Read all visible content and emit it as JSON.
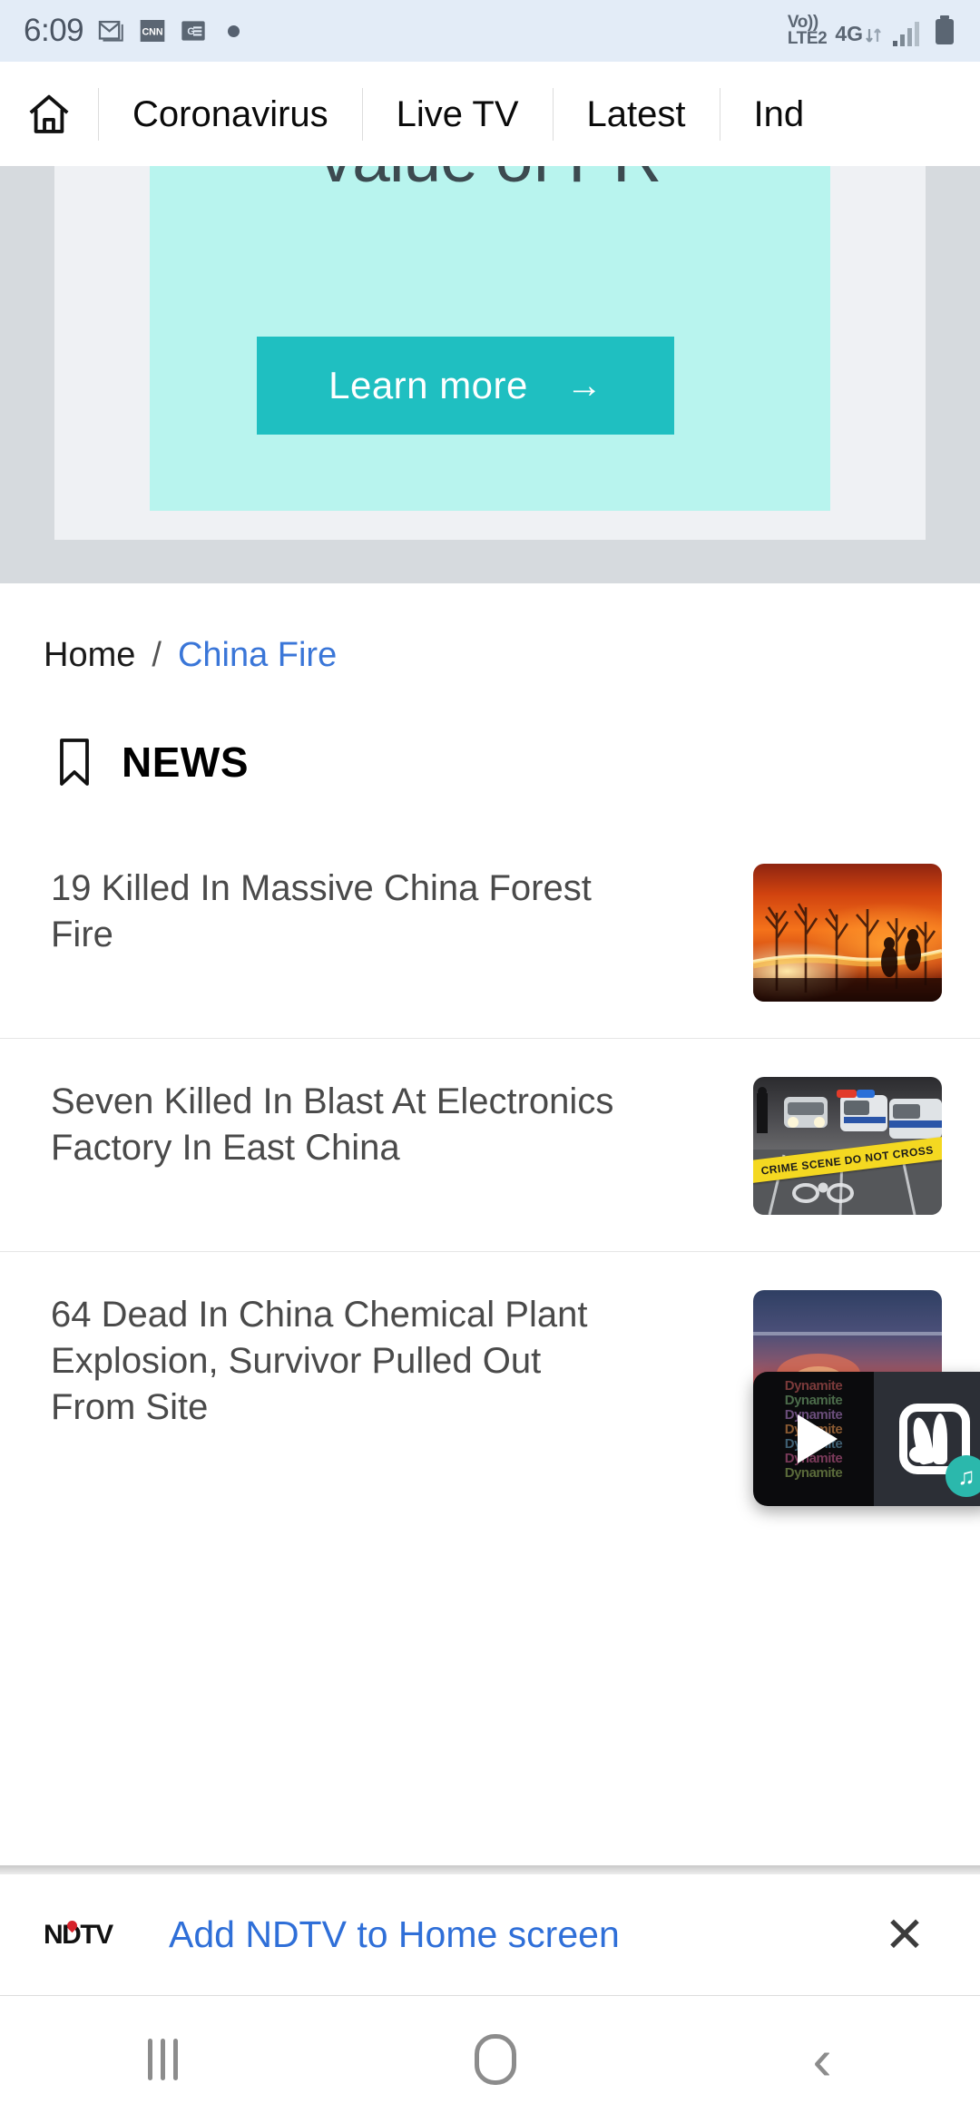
{
  "status_bar": {
    "time": "6:09",
    "icons": [
      "gmail-icon",
      "cnn-icon",
      "google-news-icon",
      "notification-dot"
    ],
    "volte_line1": "Vo))",
    "volte_line2": "LTE2",
    "network": "4G",
    "signal": "signal-bars-icon",
    "battery": "battery-full-icon"
  },
  "nav": {
    "home_icon": "home-icon",
    "items": [
      {
        "label": "Coronavirus"
      },
      {
        "label": "Live TV"
      },
      {
        "label": "Latest"
      },
      {
        "label": "Ind"
      }
    ]
  },
  "ad": {
    "headline": "value of PR",
    "button_label": "Learn more",
    "button_arrow": "→",
    "bg_color": "#b8f4ee",
    "button_color": "#1fbfc1"
  },
  "breadcrumb": {
    "home": "Home",
    "separator": "/",
    "current": "China Fire",
    "link_color": "#3a76d8"
  },
  "section": {
    "icon": "bookmark-icon",
    "title": "NEWS"
  },
  "news": [
    {
      "title": "19 Killed In Massive China Forest Fire",
      "thumbnail": "forest-fire-photo"
    },
    {
      "title": "Seven Killed In Blast At Electronics Factory In East China",
      "thumbnail": "crime-scene-tape-photo",
      "tape_text": "CRIME SCENE DO NOT CROSS"
    },
    {
      "title": "64 Dead In China Chemical Plant Explosion, Survivor Pulled Out From Site",
      "thumbnail": "explosion-photo",
      "overlay": {
        "album_text": "Dynamite",
        "play_icon": "play-icon",
        "app_icon": "jiosaavn-icon",
        "music_badge": "♫"
      }
    }
  ],
  "banner": {
    "logo": "NDTV",
    "text": "Add NDTV to Home screen",
    "close_icon": "✕"
  },
  "system_nav": {
    "recents": "recents-icon",
    "home": "home-icon",
    "back": "‹"
  }
}
